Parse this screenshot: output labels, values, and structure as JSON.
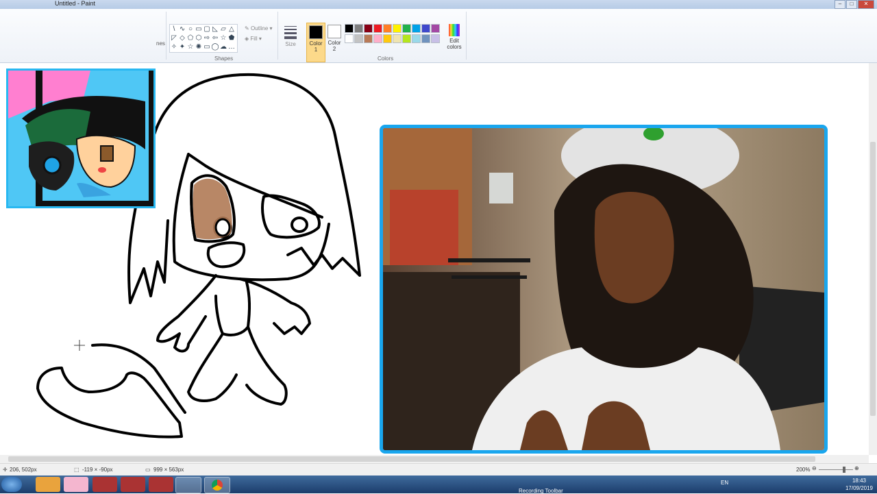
{
  "window": {
    "title": "Untitled - Paint"
  },
  "ribbon": {
    "shapes_group_label": "Shapes",
    "colors_group_label": "Colors",
    "outline_label": "Outline",
    "fill_label": "Fill",
    "size_label": "Size",
    "color1_label": "Color 1",
    "color2_label": "Color 2",
    "edit_colors_label": "Edit colors",
    "partial_label": "nes",
    "palette": [
      "#000000",
      "#7f7f7f",
      "#880015",
      "#ed1c24",
      "#ff7f27",
      "#fff200",
      "#22b14c",
      "#00a2e8",
      "#3f48cc",
      "#a349a4",
      "#ffffff",
      "#c3c3c3",
      "#b97a57",
      "#ffaec9",
      "#ffc90e",
      "#efe4b0",
      "#b5e61d",
      "#99d9ea",
      "#7092be",
      "#c8bfe7"
    ],
    "shape_glyphs": [
      "\\",
      "∿",
      "○",
      "▭",
      "▢",
      "◺",
      "▱",
      "△",
      "◸",
      "◇",
      "⬠",
      "⬡",
      "⇨",
      "⇦",
      "☆",
      "⬟",
      "✧",
      "✦",
      "☆",
      "✺",
      "▭",
      "◯",
      "☁",
      "…"
    ]
  },
  "status": {
    "cursor_pos": "206, 502px",
    "selection_size": "-119 × -90px",
    "canvas_size": "999 × 563px",
    "zoom": "200%"
  },
  "taskbar": {
    "items": [
      "start",
      "explorer",
      "media-player",
      "paint-avatar",
      "game1",
      "game2",
      "game3",
      "paint",
      "chrome"
    ],
    "lang": "EN",
    "time": "18:43",
    "date": "17/09/2019",
    "recording_label": "Recording Toolbar"
  }
}
